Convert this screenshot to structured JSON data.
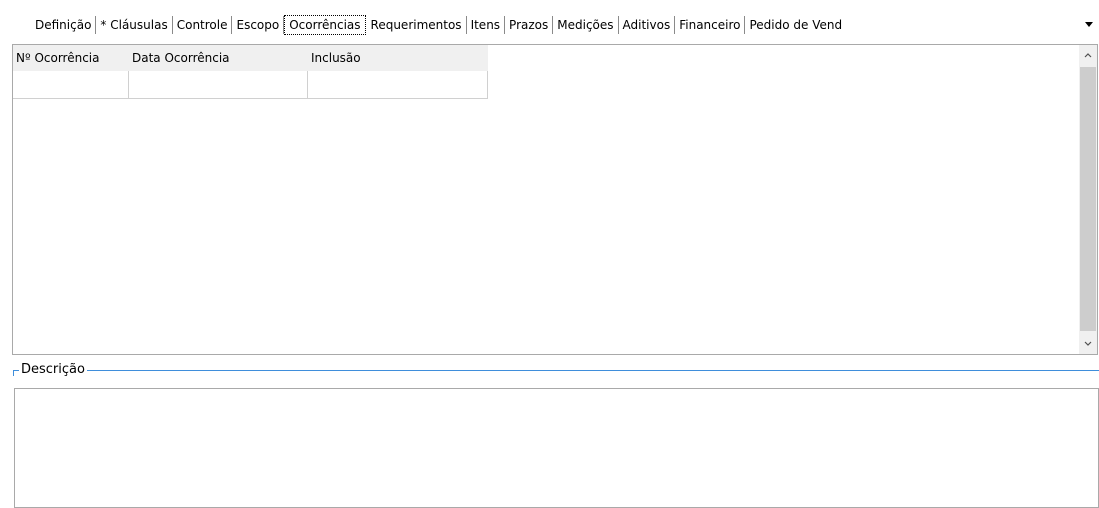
{
  "tabs": [
    {
      "label": "Definição",
      "active": false
    },
    {
      "label": "* Cláusulas",
      "active": false
    },
    {
      "label": "Controle",
      "active": false
    },
    {
      "label": "Escopo",
      "active": false
    },
    {
      "label": "Ocorrências",
      "active": true
    },
    {
      "label": "Requerimentos",
      "active": false
    },
    {
      "label": "Itens",
      "active": false
    },
    {
      "label": "Prazos",
      "active": false
    },
    {
      "label": "Medições",
      "active": false
    },
    {
      "label": "Aditivos",
      "active": false
    },
    {
      "label": "Financeiro",
      "active": false
    },
    {
      "label": "Pedido de Vend",
      "active": false
    }
  ],
  "tab_overflow_icon": "caret-down-icon",
  "grid": {
    "columns": [
      "Nº Ocorrência",
      "Data Ocorrência",
      "Inclusão"
    ],
    "rows": [
      [
        "",
        "",
        ""
      ]
    ],
    "scroll_up_icon": "chevron-up-icon",
    "scroll_down_icon": "chevron-down-icon"
  },
  "description": {
    "label": "Descrição",
    "value": ""
  },
  "colors": {
    "group_border": "#3f8edb",
    "header_bg": "#f0f0f0",
    "scroll_thumb": "#cdcdcd"
  }
}
